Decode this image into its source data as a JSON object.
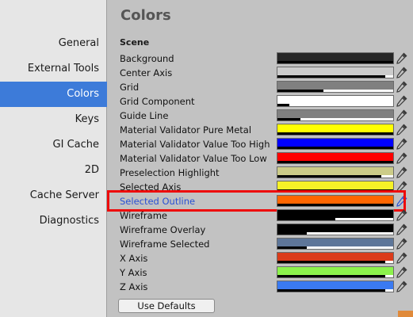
{
  "sidebar": {
    "items": [
      {
        "label": "General",
        "active": false
      },
      {
        "label": "External Tools",
        "active": false
      },
      {
        "label": "Colors",
        "active": true
      },
      {
        "label": "Keys",
        "active": false
      },
      {
        "label": "GI Cache",
        "active": false
      },
      {
        "label": "2D",
        "active": false
      },
      {
        "label": "Cache Server",
        "active": false
      },
      {
        "label": "Diagnostics",
        "active": false
      }
    ]
  },
  "main": {
    "title": "Colors",
    "section": "Scene",
    "defaults_label": "Use Defaults",
    "rows": [
      {
        "label": "Background",
        "color": "#262626",
        "alpha": 1.0
      },
      {
        "label": "Center Axis",
        "color": "#cccccc",
        "alpha": 0.93
      },
      {
        "label": "Grid",
        "color": "#808080",
        "alpha": 0.4
      },
      {
        "label": "Grid Component",
        "color": "#ffffff",
        "alpha": 0.1
      },
      {
        "label": "Guide Line",
        "color": "#808080",
        "alpha": 0.2
      },
      {
        "label": "Material Validator Pure Metal",
        "color": "#ffff00",
        "alpha": 1.0
      },
      {
        "label": "Material Validator Value Too High",
        "color": "#0000ff",
        "alpha": 1.0
      },
      {
        "label": "Material Validator Value Too Low",
        "color": "#ff0000",
        "alpha": 1.0
      },
      {
        "label": "Preselection Highlight",
        "color": "#cccc88",
        "alpha": 0.9
      },
      {
        "label": "Selected Axis",
        "color": "#f6f227",
        "alpha": 1.0
      },
      {
        "label": "Selected Outline",
        "color": "#ff6600",
        "alpha": 1.0,
        "selected": true
      },
      {
        "label": "Wireframe",
        "color": "#000000",
        "alpha": 0.5
      },
      {
        "label": "Wireframe Overlay",
        "color": "#000000",
        "alpha": 0.25
      },
      {
        "label": "Wireframe Selected",
        "color": "#5e7699",
        "alpha": 0.25
      },
      {
        "label": "X Axis",
        "color": "#db3b1a",
        "alpha": 0.93
      },
      {
        "label": "Y Axis",
        "color": "#8cf24c",
        "alpha": 0.93
      },
      {
        "label": "Z Axis",
        "color": "#3a7af2",
        "alpha": 0.93
      }
    ]
  },
  "icons": {
    "picker": "eyedropper-icon"
  }
}
